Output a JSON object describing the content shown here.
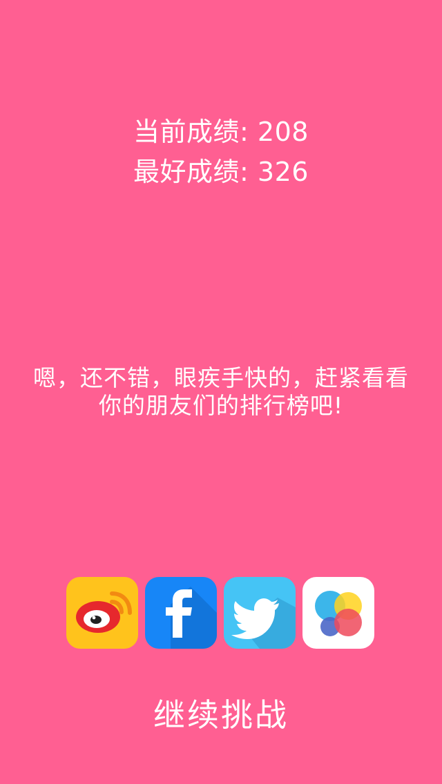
{
  "scores": {
    "current_label": "当前成绩: 208",
    "best_label": "最好成绩: 326"
  },
  "message": {
    "line1": "嗯，还不错，眼疾手快的，赶紧看看",
    "line2": "你的朋友们的排行榜吧!"
  },
  "share": {
    "icons": [
      "weibo-icon",
      "facebook-icon",
      "twitter-icon",
      "game-center-icon"
    ],
    "colors": {
      "weibo": "#ffc31c",
      "facebook": "#1786f7",
      "twitter": "#45c4f5",
      "gamecenter": "#ffffff"
    }
  },
  "actions": {
    "continue_label": "继续挑战"
  },
  "theme": {
    "background": "#ff5f92",
    "text": "#ffffff"
  }
}
